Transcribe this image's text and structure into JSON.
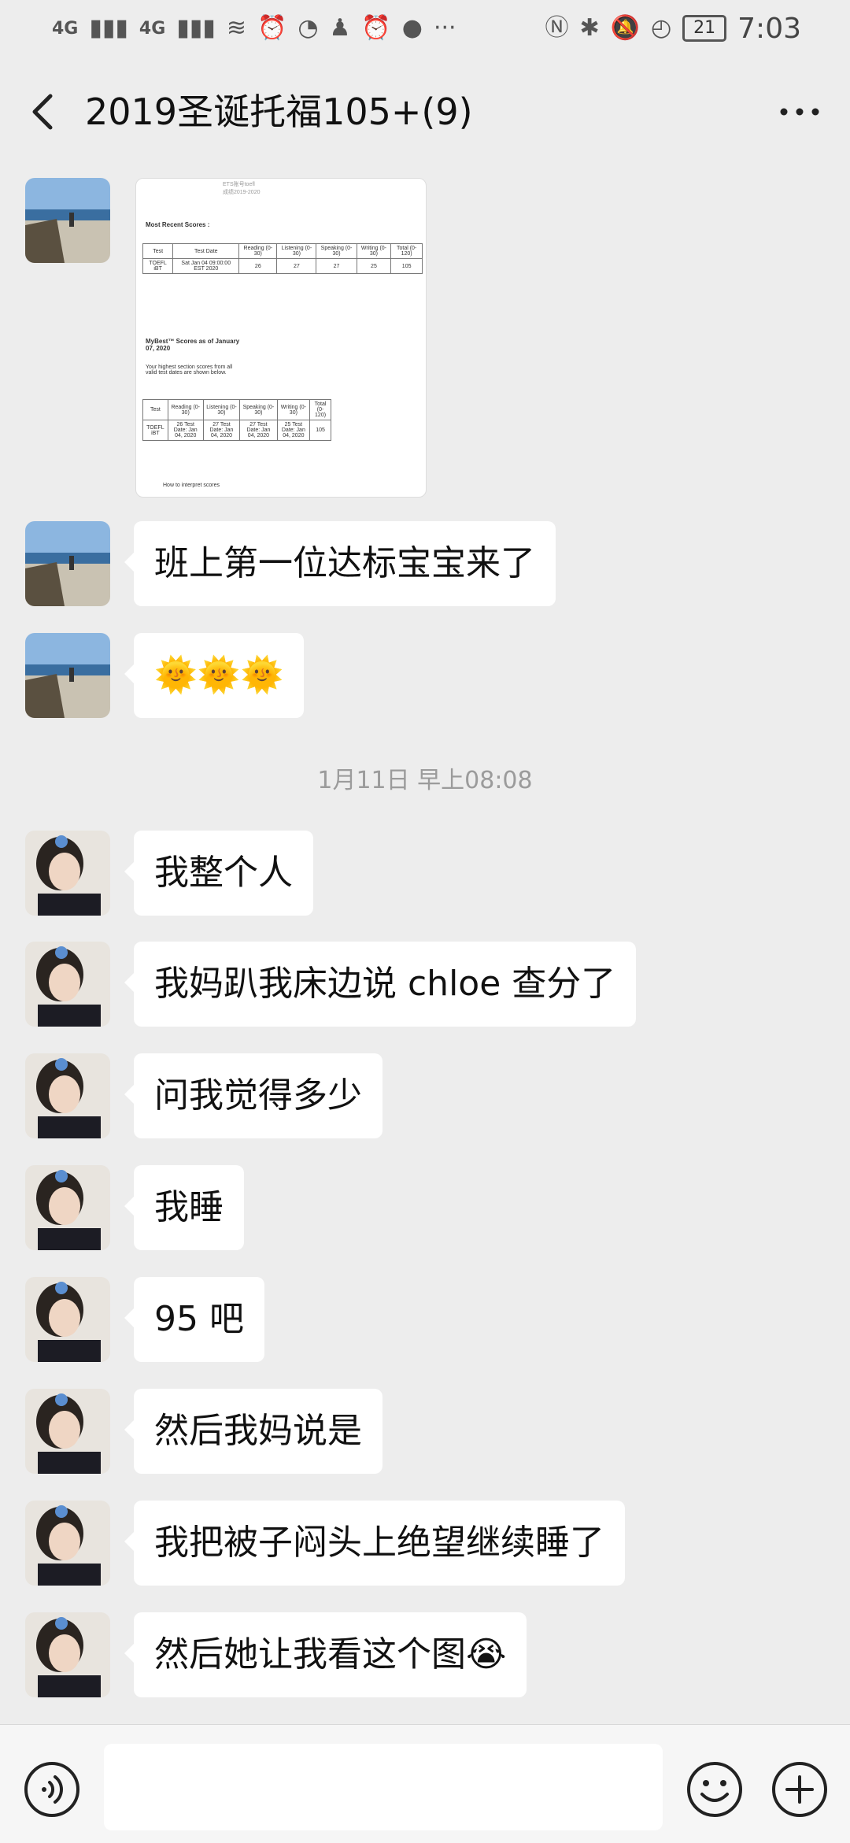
{
  "status_bar": {
    "network_1": "4G",
    "network_2": "4G",
    "battery": "21",
    "time": "7:03"
  },
  "header": {
    "title": "2019圣诞托福105+(9)",
    "back_icon": "back-arrow-icon",
    "more_icon": "more-dots-icon"
  },
  "messages": [
    {
      "sender": "user-a",
      "type": "image"
    },
    {
      "sender": "user-a",
      "type": "text",
      "text": "班上第一位达标宝宝来了"
    },
    {
      "sender": "user-a",
      "type": "emoji",
      "text": "🌞🌞🌞"
    },
    {
      "type": "timestamp",
      "text": "1月11日 早上08:08"
    },
    {
      "sender": "user-b",
      "type": "text",
      "text": "我整个人"
    },
    {
      "sender": "user-b",
      "type": "text",
      "text": "我妈趴我床边说 chloe 查分了"
    },
    {
      "sender": "user-b",
      "type": "text",
      "text": "问我觉得多少"
    },
    {
      "sender": "user-b",
      "type": "text",
      "text": "我睡"
    },
    {
      "sender": "user-b",
      "type": "text",
      "text": "95 吧"
    },
    {
      "sender": "user-b",
      "type": "text",
      "text": "然后我妈说是"
    },
    {
      "sender": "user-b",
      "type": "text",
      "text": "我把被子闷头上绝望继续睡了"
    },
    {
      "sender": "user-b",
      "type": "text",
      "text": "然后她让我看这个图😭"
    }
  ],
  "score_image": {
    "top_text": "ETS账号toefl\n成绩2019-2020",
    "recent_title": "Most Recent Scores :",
    "recent_headers": [
      "Test",
      "Test Date",
      "Reading (0-30)",
      "Listening (0-30)",
      "Speaking (0-30)",
      "Writing (0-30)",
      "Total (0-120)"
    ],
    "recent_row": [
      "TOEFL iBT",
      "Sat Jan 04 09:00:00 EST 2020",
      "26",
      "27",
      "27",
      "25",
      "105"
    ],
    "mybest_title": "MyBest™ Scores as of January 07, 2020",
    "mybest_note": "Your highest section scores from all valid test dates are shown below.",
    "mybest_headers": [
      "Test",
      "Reading (0-30)",
      "Listening (0-30)",
      "Speaking (0-30)",
      "Writing (0-30)",
      "Total (0-120)"
    ],
    "mybest_row": [
      "TOEFL iBT",
      "26 Test Date: Jan 04, 2020",
      "27 Test Date: Jan 04, 2020",
      "27 Test Date: Jan 04, 2020",
      "25 Test Date: Jan 04, 2020",
      "105"
    ],
    "footer": "How to interpret scores"
  },
  "input_bar": {
    "voice_icon": "voice-icon",
    "emoji_icon": "emoji-icon",
    "plus_icon": "plus-icon",
    "input_value": ""
  },
  "colors": {
    "background": "#ededed",
    "bubble": "#ffffff",
    "timestamp": "#9b9b9b"
  }
}
